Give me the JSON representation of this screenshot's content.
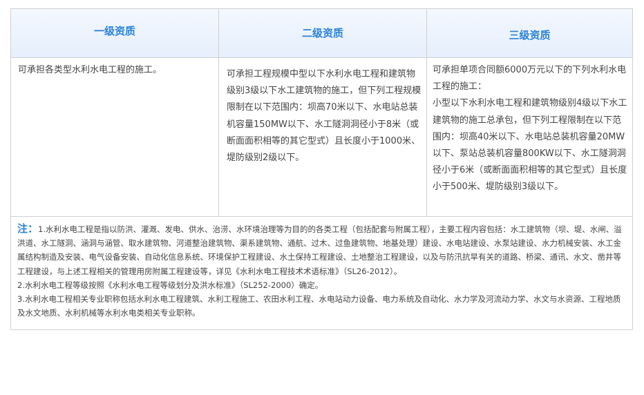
{
  "headers": [
    "一级资质",
    "二级资质",
    "三级资质"
  ],
  "cells": {
    "grade1": "可承担各类型水利水电工程的施工。",
    "grade2": "可承担工程规模中型以下水利水电工程和建筑物级别3级以下水工建筑物的施工，但下列工程规模限制在以下范围内：坝高70米以下、水电站总装机容量150MW以下、水工隧洞洞径小于8米（或断面面积相等的其它型式）且长度小于1000米、堤防级别2级以下。",
    "grade3_line1": "可承担单项合同额6000万元以下的下列水利水电工程的施工：",
    "grade3_line2": "小型以下水利水电工程和建筑物级别4级以下水工建筑物的施工总承包，但下列工程限制在以下范围内：坝高40米以下、水电站总装机容量20MW以下、泵站总装机容量800KW以下、水工隧洞洞径小于6米（或断面面积相等的其它型式）且长度小于500米、堤防级别3级以下。"
  },
  "notes": {
    "label": "注：",
    "note1": "1.水利水电工程是指以防洪、灌溉、发电、供水、治涝、水环境治理等为目的的各类工程（包括配套与附属工程），主要工程内容包括：水工建筑物（坝、堤、水闸、溢洪道、水工隧洞、涵洞与涵管、取水建筑物、河道整治建筑物、渠系建筑物、通航、过木、过鱼建筑物、地基处理）建设、水电站建设、水泵站建设、水力机械安装、水工金属结构制造及安装、电气设备安装、自动化信息系统、环境保护工程建设、水土保持工程建设、土地整治工程建设，以及与防汛抗旱有关的道路、桥梁、通讯、水文、凿井等工程建设，与上述工程相关的管理用房附属工程建设等，详见《水利水电工程技术术语标准》（SL26-2012）。",
    "note2": "2.水利水电工程等级按照《水利水电工程等级划分及洪水标准》（SL252-2000）确定。",
    "note3": "3.水利水电工程相关专业职称包括水利水电工程建筑、水利工程施工、农田水利工程、水电站动力设备、电力系统及自动化、水力学及河流动力学、水文与水资源、工程地质及水文地质、水利机械等水利水电类相关专业职称。"
  },
  "colors": {
    "accent": "#2b82d9",
    "border": "#cfcfcf",
    "header_bg": "#e9f1fc",
    "text": "#444444"
  }
}
